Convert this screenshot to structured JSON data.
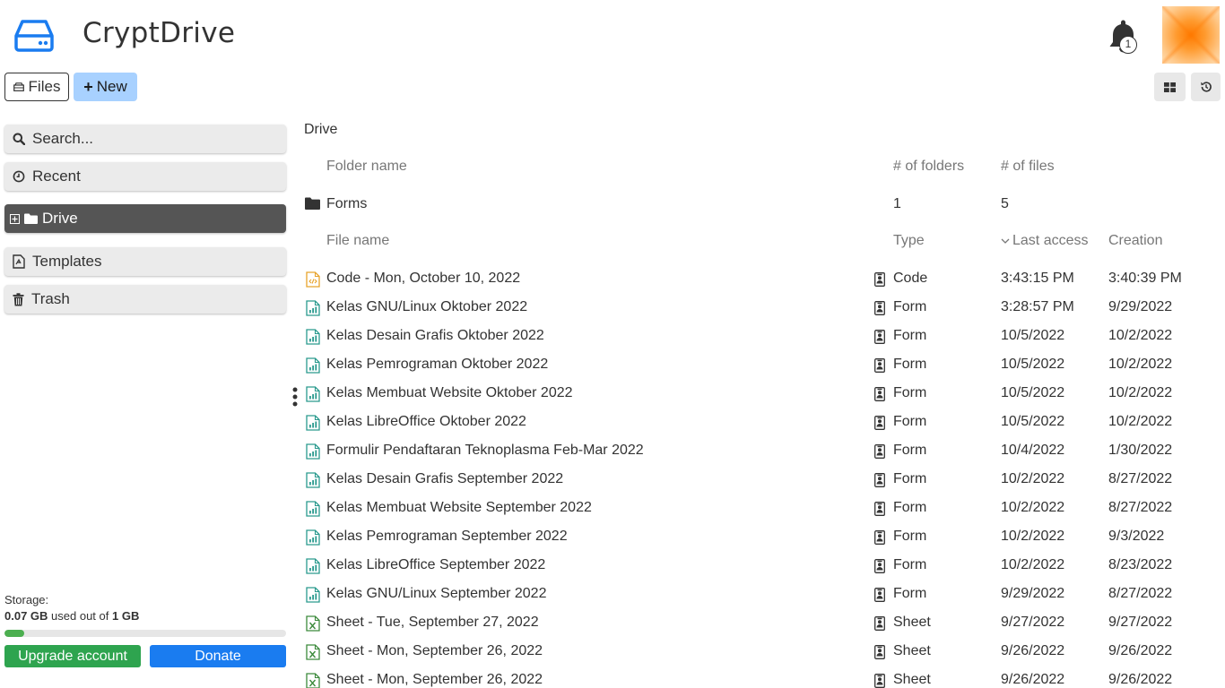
{
  "app": {
    "title": "CryptDrive",
    "notification_count": "1"
  },
  "toolbar": {
    "files_label": "Files",
    "new_label": "New"
  },
  "sidebar": {
    "search_placeholder": "Search...",
    "items": [
      {
        "label": "Recent",
        "icon": "clock-icon"
      },
      {
        "label": "Drive",
        "icon": "folder-icon",
        "active": true
      },
      {
        "label": "Templates",
        "icon": "template-icon"
      },
      {
        "label": "Trash",
        "icon": "trash-icon"
      }
    ],
    "storage": {
      "label": "Storage:",
      "used": "0.07 GB",
      "used_text": "used out of",
      "total": "1 GB",
      "used_fraction": 0.07,
      "upgrade_label": "Upgrade account",
      "donate_label": "Donate"
    }
  },
  "main": {
    "path": "Drive",
    "folder_headers": {
      "name": "Folder name",
      "folders": "# of folders",
      "files": "# of files"
    },
    "folders": [
      {
        "name": "Forms",
        "folders": "1",
        "files": "5"
      }
    ],
    "file_headers": {
      "name": "File name",
      "type": "Type",
      "last_access": "Last access",
      "creation": "Creation"
    },
    "files": [
      {
        "name": "Code - Mon, October 10, 2022",
        "type": "Code",
        "last_access": "3:43:15 PM",
        "creation": "3:40:39 PM",
        "kind": "code"
      },
      {
        "name": "Kelas GNU/Linux Oktober 2022",
        "type": "Form",
        "last_access": "3:28:57 PM",
        "creation": "9/29/2022",
        "kind": "form"
      },
      {
        "name": "Kelas Desain Grafis Oktober 2022",
        "type": "Form",
        "last_access": "10/5/2022",
        "creation": "10/2/2022",
        "kind": "form"
      },
      {
        "name": "Kelas Pemrograman Oktober 2022",
        "type": "Form",
        "last_access": "10/5/2022",
        "creation": "10/2/2022",
        "kind": "form"
      },
      {
        "name": "Kelas Membuat Website Oktober 2022",
        "type": "Form",
        "last_access": "10/5/2022",
        "creation": "10/2/2022",
        "kind": "form"
      },
      {
        "name": "Kelas LibreOffice Oktober 2022",
        "type": "Form",
        "last_access": "10/5/2022",
        "creation": "10/2/2022",
        "kind": "form"
      },
      {
        "name": "Formulir Pendaftaran Teknoplasma Feb-Mar 2022",
        "type": "Form",
        "last_access": "10/4/2022",
        "creation": "1/30/2022",
        "kind": "form"
      },
      {
        "name": "Kelas Desain Grafis September 2022",
        "type": "Form",
        "last_access": "10/2/2022",
        "creation": "8/27/2022",
        "kind": "form"
      },
      {
        "name": "Kelas Membuat Website September 2022",
        "type": "Form",
        "last_access": "10/2/2022",
        "creation": "8/27/2022",
        "kind": "form"
      },
      {
        "name": "Kelas Pemrograman September 2022",
        "type": "Form",
        "last_access": "10/2/2022",
        "creation": "9/3/2022",
        "kind": "form"
      },
      {
        "name": "Kelas LibreOffice September 2022",
        "type": "Form",
        "last_access": "10/2/2022",
        "creation": "8/23/2022",
        "kind": "form"
      },
      {
        "name": "Kelas GNU/Linux September 2022",
        "type": "Form",
        "last_access": "9/29/2022",
        "creation": "8/27/2022",
        "kind": "form"
      },
      {
        "name": "Sheet - Tue, September 27, 2022",
        "type": "Sheet",
        "last_access": "9/27/2022",
        "creation": "9/27/2022",
        "kind": "sheet"
      },
      {
        "name": "Sheet - Mon, September 26, 2022",
        "type": "Sheet",
        "last_access": "9/26/2022",
        "creation": "9/26/2022",
        "kind": "sheet"
      },
      {
        "name": "Sheet - Mon, September 26, 2022",
        "type": "Sheet",
        "last_access": "9/26/2022",
        "creation": "9/26/2022",
        "kind": "sheet"
      }
    ]
  },
  "colors": {
    "accent": "#1a7cf0",
    "new_button": "#a8d1ff",
    "upgrade": "#2ea44f",
    "active_sidebar": "#555555",
    "code_icon": "#e8a32b",
    "form_icon": "#2a9a8e",
    "sheet_icon": "#3c8a3c"
  }
}
